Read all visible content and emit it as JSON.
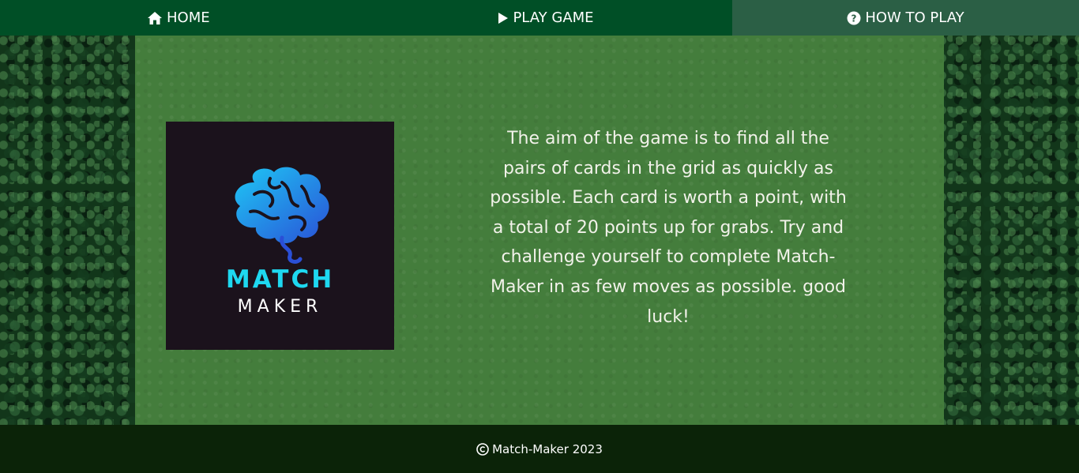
{
  "nav": {
    "items": [
      {
        "label": "HOME",
        "icon": "home-icon"
      },
      {
        "label": "PLAY GAME",
        "icon": "play-icon"
      },
      {
        "label": "HOW TO PLAY",
        "icon": "question-circle-icon"
      }
    ],
    "active_item": "HOW TO PLAY"
  },
  "logo": {
    "title": "MATCH",
    "subtitle": "MAKER",
    "icon": "brain-icon"
  },
  "description": "The aim of the game is to find all the pairs of cards in the grid as quickly as possible. Each card is worth a point, with a total of 20 points up for grabs. Try and challenge yourself to complete Match-Maker in as few moves as possible. good luck!",
  "footer": {
    "text": "Match-Maker 2023",
    "icon": "copyright-icon"
  },
  "colors": {
    "nav_bg": "#004f26",
    "nav_active_bg": "#2b5f45",
    "panel_bg": "#447d3c",
    "logo_bg": "#1b121c",
    "logo_accent": "#1ed8f0",
    "footer_bg": "#0b2308"
  }
}
